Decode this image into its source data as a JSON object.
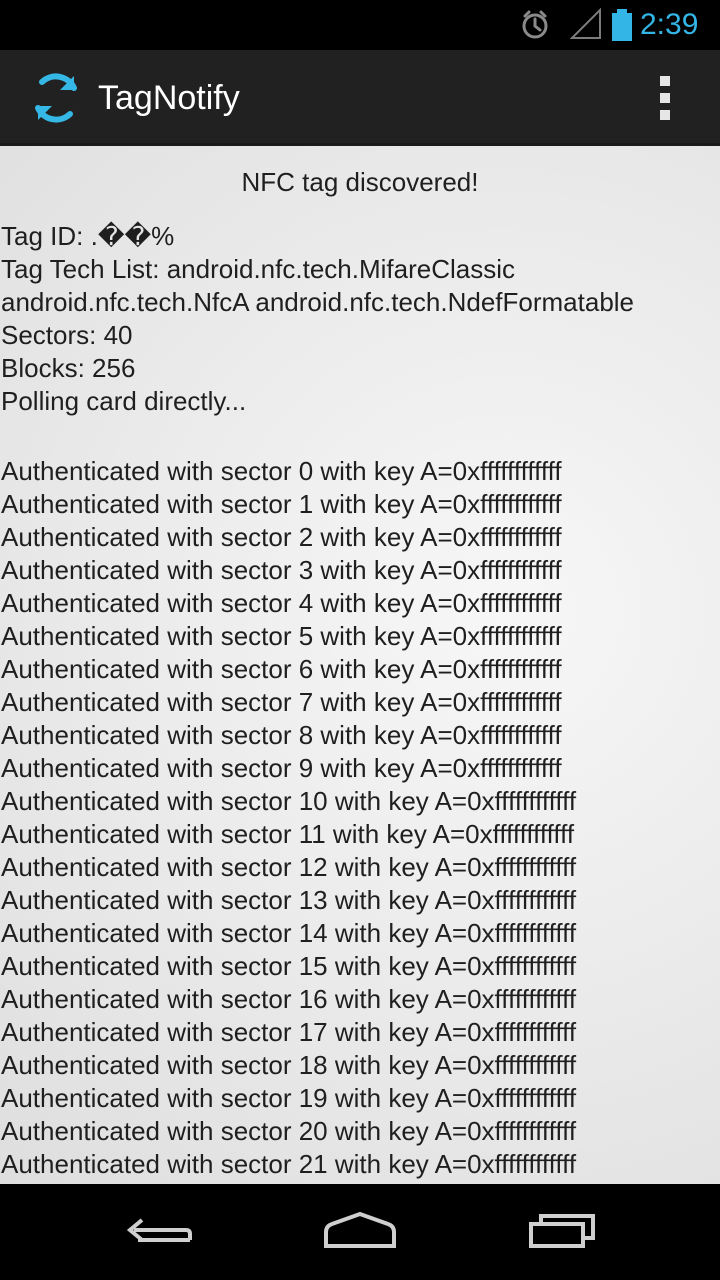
{
  "status_bar": {
    "time": "2:39",
    "icons": [
      "alarm-icon",
      "signal-icon",
      "battery-icon"
    ],
    "accent_color": "#33b5e5"
  },
  "action_bar": {
    "title": "TagNotify",
    "icon": "sync-icon",
    "overflow_icon": "overflow-menu-icon",
    "background": "#212121"
  },
  "content": {
    "header": "NFC tag discovered!",
    "info_lines": [
      "Tag ID: .��%",
      "Tag Tech List: android.nfc.tech.MifareClassic android.nfc.tech.NfcA android.nfc.tech.NdefFormatable",
      "Sectors: 40",
      "Blocks: 256",
      "Polling card directly..."
    ],
    "log_lines": [
      "Authenticated with sector 0 with key A=0xffffffffffff",
      "Authenticated with sector 1 with key A=0xffffffffffff",
      "Authenticated with sector 2 with key A=0xffffffffffff",
      "Authenticated with sector 3 with key A=0xffffffffffff",
      "Authenticated with sector 4 with key A=0xffffffffffff",
      "Authenticated with sector 5 with key A=0xffffffffffff",
      "Authenticated with sector 6 with key A=0xffffffffffff",
      "Authenticated with sector 7 with key A=0xffffffffffff",
      "Authenticated with sector 8 with key A=0xffffffffffff",
      "Authenticated with sector 9 with key A=0xffffffffffff",
      "Authenticated with sector 10 with key A=0xffffffffffff",
      "Authenticated with sector 11 with key A=0xffffffffffff",
      "Authenticated with sector 12 with key A=0xffffffffffff",
      "Authenticated with sector 13 with key A=0xffffffffffff",
      "Authenticated with sector 14 with key A=0xffffffffffff",
      "Authenticated with sector 15 with key A=0xffffffffffff",
      "Authenticated with sector 16 with key A=0xffffffffffff",
      "Authenticated with sector 17 with key A=0xffffffffffff",
      "Authenticated with sector 18 with key A=0xffffffffffff",
      "Authenticated with sector 19 with key A=0xffffffffffff",
      "Authenticated with sector 20 with key A=0xffffffffffff",
      "Authenticated with sector 21 with key A=0xffffffffffff"
    ]
  },
  "navigation": {
    "buttons": [
      "back-icon",
      "home-icon",
      "recent-apps-icon"
    ]
  }
}
